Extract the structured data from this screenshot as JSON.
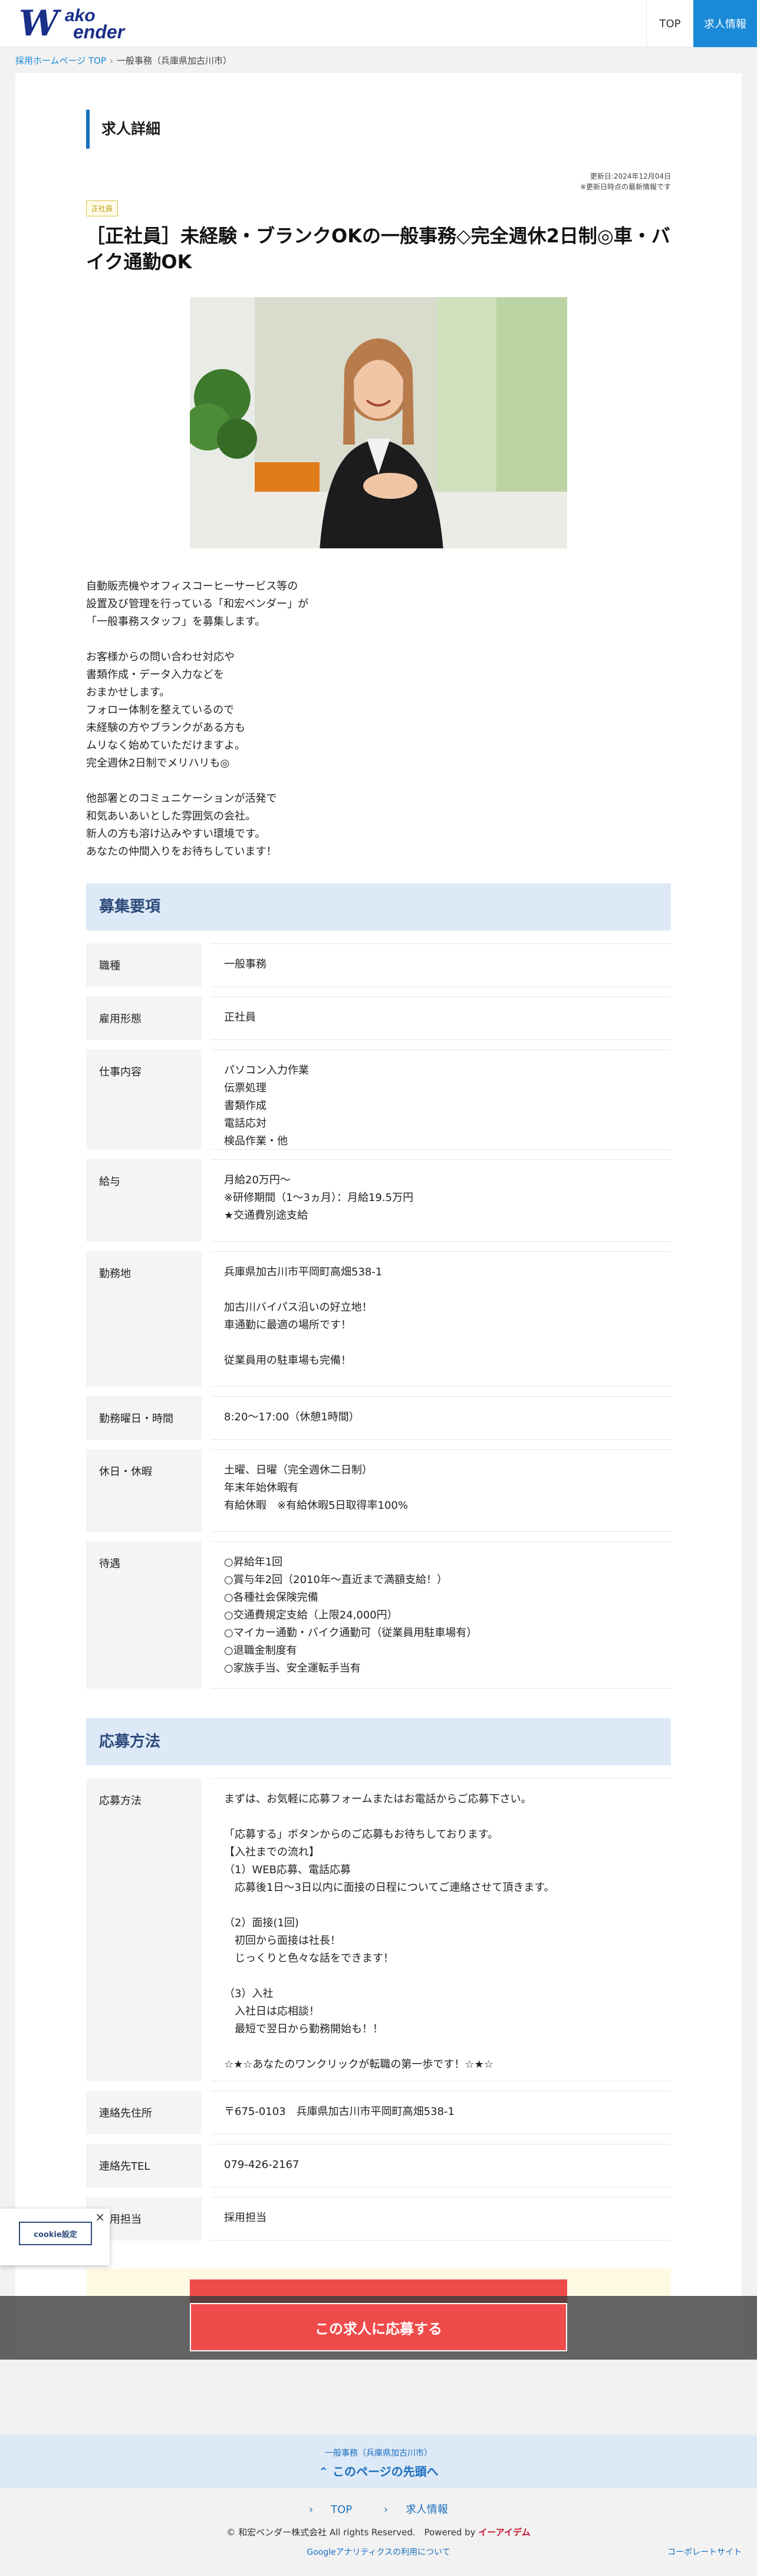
{
  "header": {
    "logo_w": "W",
    "logo_ako": "ako",
    "logo_ender": "ender",
    "nav_top": "TOP",
    "nav_jobs": "求人情報"
  },
  "breadcrumb": {
    "home": "採用ホームページ TOP",
    "current": "一般事務（兵庫県加古川市）"
  },
  "page": {
    "section_title": "求人詳細",
    "updated_date": "更新日:2024年12月04日",
    "updated_note": "※更新日時点の最新情報です",
    "badge": "正社員",
    "job_title": "［正社員］未経験・ブランクOKの一般事務◇完全週休2日制◎車・バイク通勤OK"
  },
  "intro": [
    [
      "自動販売機やオフィスコーヒーサービス等の",
      "設置及び管理を行っている「和宏ベンダー」が",
      "「一般事務スタッフ」を募集します。"
    ],
    [
      "お客様からの問い合わせ対応や",
      "書類作成・データ入力などを",
      "おまかせします。",
      "フォロー体制を整えているので",
      "未経験の方やブランクがある方も",
      "ムリなく始めていただけますよ。",
      "完全週休2日制でメリハリも◎"
    ],
    [
      "他部署とのコミュニケーションが活発で",
      "和気あいあいとした雰囲気の会社。",
      "新人の方も溶け込みやすい環境です。",
      "あなたの仲間入りをお待ちしています！"
    ]
  ],
  "recruit": {
    "heading": "募集要項",
    "rows": [
      {
        "label": "職種",
        "lines": [
          "一般事務"
        ]
      },
      {
        "label": "雇用形態",
        "lines": [
          "正社員"
        ]
      },
      {
        "label": "仕事内容",
        "lines": [
          "パソコン入力作業",
          "伝票処理",
          "書類作成",
          "電話応対",
          "検品作業・他"
        ]
      },
      {
        "label": "給与",
        "lines": [
          "月給20万円～",
          "※研修期間（1～3ヵ月）：月給19.5万円",
          "★交通費別途支給"
        ]
      },
      {
        "label": "勤務地",
        "lines": [
          "兵庫県加古川市平岡町高畑538-1",
          "",
          "加古川バイパス沿いの好立地！",
          "車通勤に最適の場所です！",
          "",
          "従業員用の駐車場も完備！"
        ]
      },
      {
        "label": "勤務曜日・時間",
        "lines": [
          "8:20～17:00（休憩1時間）"
        ]
      },
      {
        "label": "休日・休暇",
        "lines": [
          "土曜、日曜（完全週休二日制）",
          "年末年始休暇有",
          "有給休暇　※有給休暇5日取得率100%"
        ]
      },
      {
        "label": "待遇",
        "lines": [
          "○昇給年1回",
          "○賞与年2回（2010年～直近まで満額支給！）",
          "○各種社会保険完備",
          "○交通費規定支給（上限24,000円）",
          "○マイカー通勤・バイク通勤可（従業員用駐車場有）",
          "○退職金制度有",
          "○家族手当、安全運転手当有"
        ]
      }
    ]
  },
  "apply": {
    "heading": "応募方法",
    "rows": [
      {
        "label": "応募方法",
        "lines": [
          "まずは、お気軽に応募フォームまたはお電話からご応募下さい。",
          "",
          "「応募する」ボタンからのご応募もお待ちしております。",
          "【入社までの流れ】",
          "（1）WEB応募、電話応募",
          "　応募後1日～3日以内に面接の日程についてご連絡させて頂きます。",
          "",
          "（2）面接(1回)",
          "　初回から面接は社長！",
          "　じっくりと色々な話をできます！",
          "",
          "（3）入社",
          "　入社日は応相談！",
          "　最短で翌日から勤務開始も！！",
          "",
          "☆★☆あなたのワンクリックが転職の第一歩です！☆★☆"
        ]
      },
      {
        "label": "連絡先住所",
        "lines": [
          "〒675-0103　兵庫県加古川市平岡町高畑538-1"
        ]
      },
      {
        "label": "連絡先TEL",
        "lines": [
          "079-426-2167"
        ]
      },
      {
        "label": "採用担当",
        "lines": [
          "採用担当"
        ]
      }
    ],
    "button_label": "この求人に応募する"
  },
  "cookie": {
    "close": "×",
    "button": "cookie設定"
  },
  "footer": {
    "crumb": "一般事務（兵庫県加古川市）",
    "back_top": "このページの先頭へ",
    "link_top": "TOP",
    "link_jobs": "求人情報",
    "copyright": "© 和宏ベンダー株式会社 All rights Reserved.　Powered by",
    "powered_by": "イーアイデム",
    "analytics": "Googleアナリティクスの利用について",
    "corp_site": "コーポレートサイト"
  },
  "colors": {
    "brand": "#1a2f8a",
    "accent": "#1a8ad8",
    "apply": "#ef4b4b",
    "band": "#dde9f7"
  }
}
